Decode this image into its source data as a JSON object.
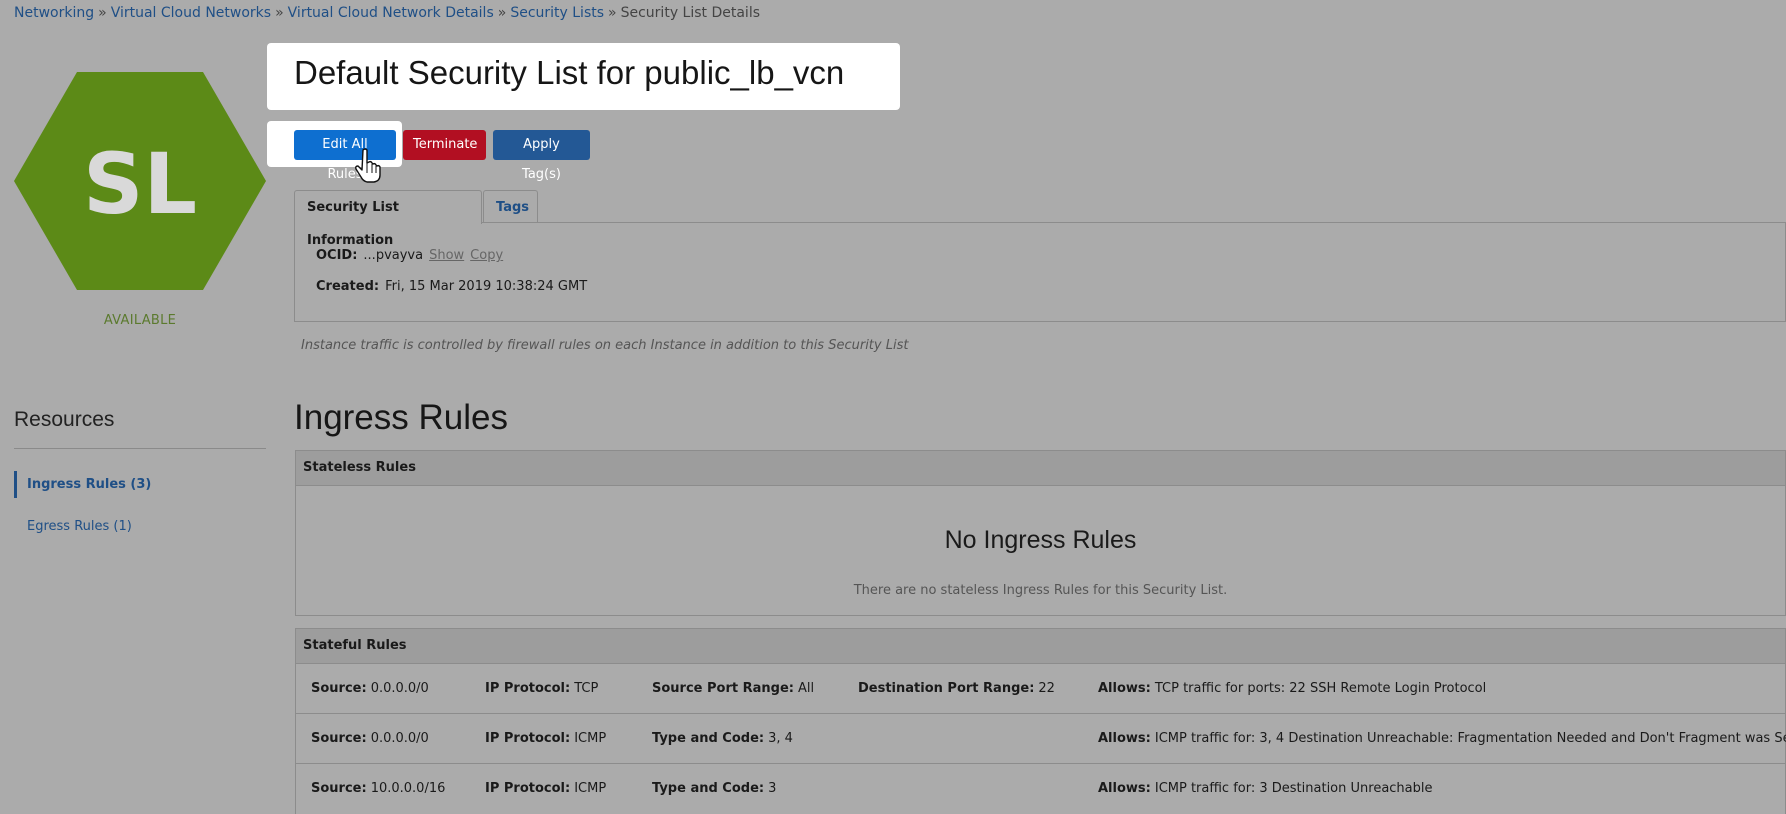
{
  "breadcrumb": {
    "items": [
      "Networking",
      "Virtual Cloud Networks",
      "Virtual Cloud Network Details",
      "Security Lists"
    ],
    "current": "Security List Details",
    "separator": "»"
  },
  "resource": {
    "badge_text": "SL",
    "badge_color": "#5c8a17",
    "status": "AVAILABLE",
    "title": "Default Security List for public_lb_vcn"
  },
  "actions": {
    "edit_label": "Edit All Rules",
    "terminate_label": "Terminate",
    "apply_tags_label": "Apply Tag(s)"
  },
  "tabs": [
    {
      "label": "Security List Information"
    },
    {
      "label": "Tags"
    }
  ],
  "info": {
    "ocid_label": "OCID:",
    "ocid_value": "...pvayva",
    "show_label": "Show",
    "copy_label": "Copy",
    "created_label": "Created:",
    "created_value": "Fri, 15 Mar 2019 10:38:24 GMT"
  },
  "note": "Instance traffic is controlled by firewall rules on each Instance in addition to this Security List",
  "sidebar": {
    "title": "Resources",
    "items": [
      {
        "label": "Ingress Rules (3)"
      },
      {
        "label": "Egress Rules (1)"
      }
    ]
  },
  "ingress": {
    "title": "Ingress Rules",
    "stateless_title": "Stateless Rules",
    "empty_title": "No Ingress Rules",
    "empty_sub": "There are no stateless Ingress Rules for this Security List.",
    "stateful_title": "Stateful Rules",
    "rows": [
      {
        "source_label": "Source:",
        "source": "0.0.0.0/0",
        "proto_label": "IP Protocol:",
        "proto": "TCP",
        "k3_label": "Source Port Range:",
        "k3": "All",
        "k4_label": "Destination Port Range:",
        "k4": "22",
        "allows_label": "Allows:",
        "allows": "TCP traffic for ports: 22 SSH Remote Login Protocol"
      },
      {
        "source_label": "Source:",
        "source": "0.0.0.0/0",
        "proto_label": "IP Protocol:",
        "proto": "ICMP",
        "k3_label": "Type and Code:",
        "k3": "3, 4",
        "allows_label": "Allows:",
        "allows": "ICMP traffic for: 3, 4 Destination Unreachable: Fragmentation Needed and Don't Fragment was Set"
      },
      {
        "source_label": "Source:",
        "source": "10.0.0.0/16",
        "proto_label": "IP Protocol:",
        "proto": "ICMP",
        "k3_label": "Type and Code:",
        "k3": "3",
        "allows_label": "Allows:",
        "allows": "ICMP traffic for: 3 Destination Unreachable"
      }
    ]
  }
}
